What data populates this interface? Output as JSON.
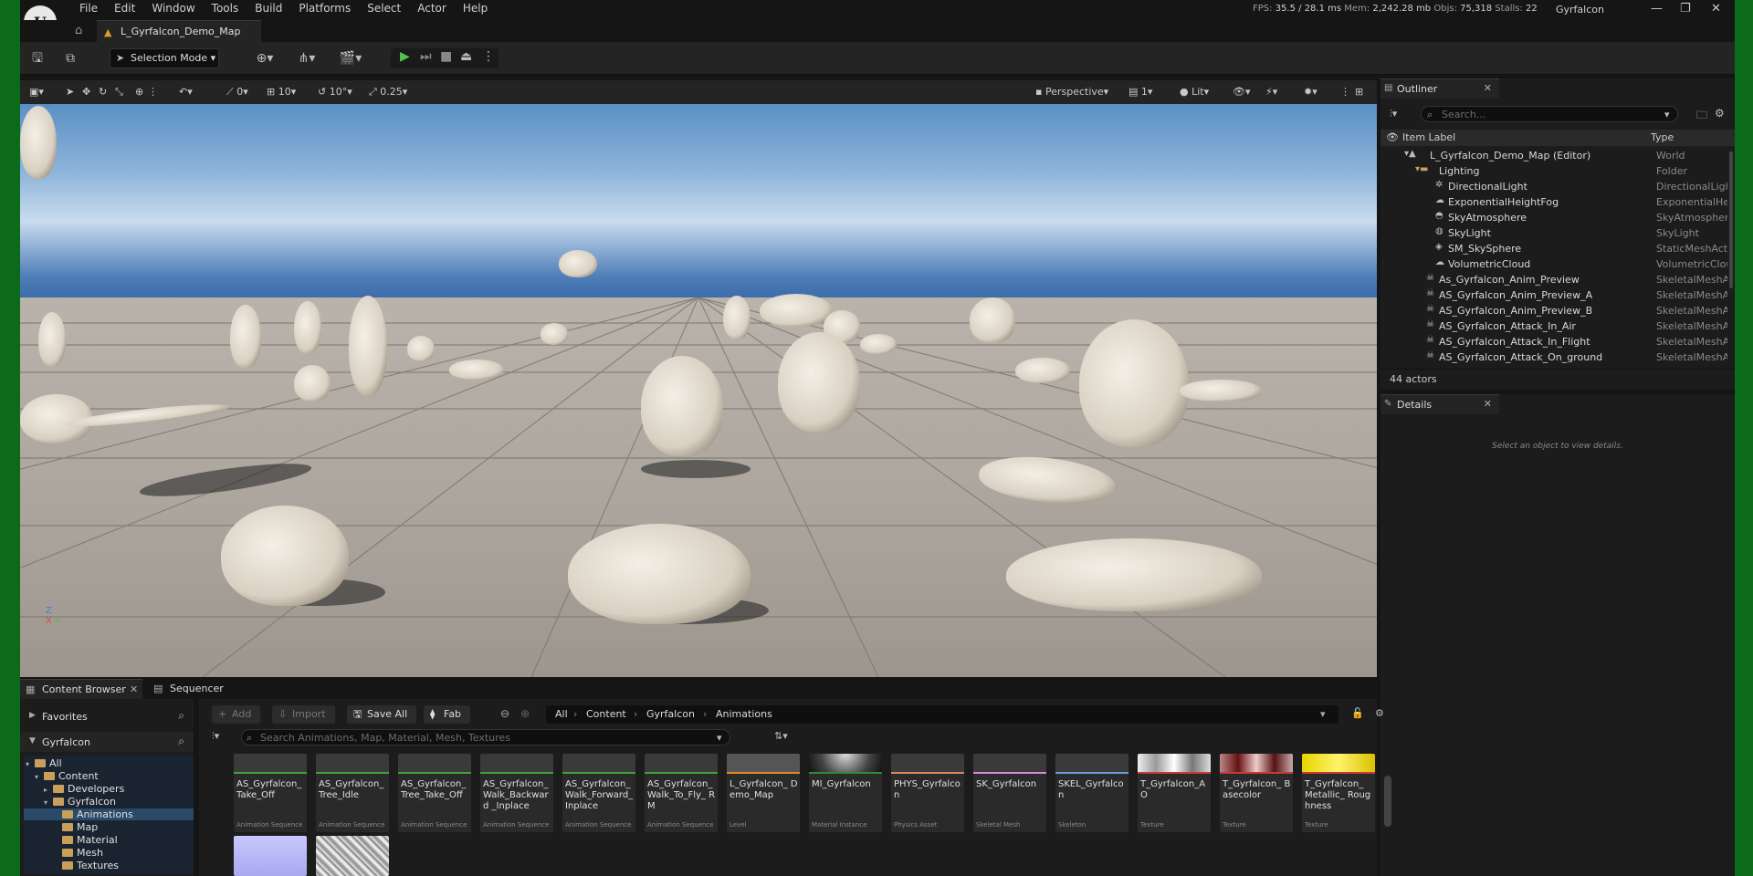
{
  "menu": [
    "File",
    "Edit",
    "Window",
    "Tools",
    "Build",
    "Platforms",
    "Select",
    "Actor",
    "Help"
  ],
  "stats": {
    "fps_label": "FPS:",
    "fps": "35.5",
    "ms": "/ 28.1 ms",
    "mem_label": "Mem:",
    "mem": "2,242.28 mb",
    "objs_label": "Objs:",
    "objs": "75,318",
    "stalls_label": "Stalls:",
    "stalls": "22"
  },
  "project_name": "Gyrfalcon",
  "level_tab": "L_Gyrfalcon_Demo_Map",
  "toolbar": {
    "selection_mode": "Selection Mode"
  },
  "viewport_toolbar": {
    "rot_snap": "0",
    "grid_snap": "10",
    "angle_snap": "10°",
    "scale_snap": "0.25",
    "perspective": "Perspective",
    "camera_speed": "1",
    "lit": "Lit"
  },
  "outliner": {
    "title": "Outliner",
    "search_placeholder": "Search...",
    "col_label": "Item Label",
    "col_type": "Type",
    "rows": [
      {
        "label": "L_Gyrfalcon_Demo_Map (Editor)",
        "type": "World"
      },
      {
        "label": "Lighting",
        "type": "Folder"
      },
      {
        "label": "DirectionalLight",
        "type": "DirectionalLight"
      },
      {
        "label": "ExponentialHeightFog",
        "type": "ExponentialHeight"
      },
      {
        "label": "SkyAtmosphere",
        "type": "SkyAtmosphere"
      },
      {
        "label": "SkyLight",
        "type": "SkyLight"
      },
      {
        "label": "SM_SkySphere",
        "type": "StaticMeshActor"
      },
      {
        "label": "VolumetricCloud",
        "type": "VolumetricCloud"
      },
      {
        "label": "As_Gyrfalcon_Anim_Preview",
        "type": "SkeletalMeshActor"
      },
      {
        "label": "AS_Gyrfalcon_Anim_Preview_A",
        "type": "SkeletalMeshActor"
      },
      {
        "label": "AS_Gyrfalcon_Anim_Preview_B",
        "type": "SkeletalMeshActor"
      },
      {
        "label": "AS_Gyrfalcon_Attack_In_Air",
        "type": "SkeletalMeshActor"
      },
      {
        "label": "AS_Gyrfalcon_Attack_In_Flight",
        "type": "SkeletalMeshActor"
      },
      {
        "label": "AS_Gyrfalcon_Attack_On_ground",
        "type": "SkeletalMeshActor"
      }
    ],
    "count": "44 actors"
  },
  "details": {
    "title": "Details",
    "empty_message": "Select an object to view details."
  },
  "bottom_tabs": {
    "content_browser": "Content Browser",
    "sequencer": "Sequencer"
  },
  "content_browser": {
    "favorites": "Favorites",
    "root": "Gyrfalcon",
    "tree": [
      "All",
      "Content",
      "Developers",
      "Gyrfalcon",
      "Animations",
      "Map",
      "Material",
      "Mesh",
      "Textures"
    ],
    "add": "Add",
    "import": "Import",
    "save_all": "Save All",
    "fab": "Fab",
    "path": [
      "All",
      "Content",
      "Gyrfalcon",
      "Animations"
    ],
    "search_placeholder": "Search Animations, Map, Material, Mesh, Textures",
    "assets": [
      {
        "name": "AS_Gyrfalcon_ Take_Off",
        "kind": "Animation Sequence",
        "color": "#3fa33a"
      },
      {
        "name": "AS_Gyrfalcon_ Tree_Idle",
        "kind": "Animation Sequence",
        "color": "#3fa33a"
      },
      {
        "name": "AS_Gyrfalcon_ Tree_Take_Off",
        "kind": "Animation Sequence",
        "color": "#3fa33a"
      },
      {
        "name": "AS_Gyrfalcon_ Walk_Backward _Inplace",
        "kind": "Animation Sequence",
        "color": "#3fa33a"
      },
      {
        "name": "AS_Gyrfalcon_ Walk_Forward_ Inplace",
        "kind": "Animation Sequence",
        "color": "#3fa33a"
      },
      {
        "name": "AS_Gyrfalcon_ Walk_To_Fly_ RM",
        "kind": "Animation Sequence",
        "color": "#3fa33a"
      },
      {
        "name": "L_Gyrfalcon_ Demo_Map",
        "kind": "Level",
        "color": "#e08a22"
      },
      {
        "name": "MI_Gyrfalcon",
        "kind": "Material Instance",
        "color": "#2f8a3a"
      },
      {
        "name": "PHYS_Gyrfalcon",
        "kind": "Physics Asset",
        "color": "#d98a5a"
      },
      {
        "name": "SK_Gyrfalcon",
        "kind": "Skeletal Mesh",
        "color": "#d68ad8"
      },
      {
        "name": "SKEL_Gyrfalcon",
        "kind": "Skeleton",
        "color": "#6a9ad8"
      },
      {
        "name": "T_Gyrfalcon_AO",
        "kind": "Texture",
        "color": "#c83a3a"
      },
      {
        "name": "T_Gyrfalcon_ Basecolor",
        "kind": "Texture",
        "color": "#c83a3a"
      },
      {
        "name": "T_Gyrfalcon_ Metallic_ Roughness",
        "kind": "Texture",
        "color": "#c83a3a"
      }
    ]
  },
  "colors": {
    "accent": "#3fa33a",
    "folder": "#c9a05a",
    "selection": "#1a2430"
  }
}
